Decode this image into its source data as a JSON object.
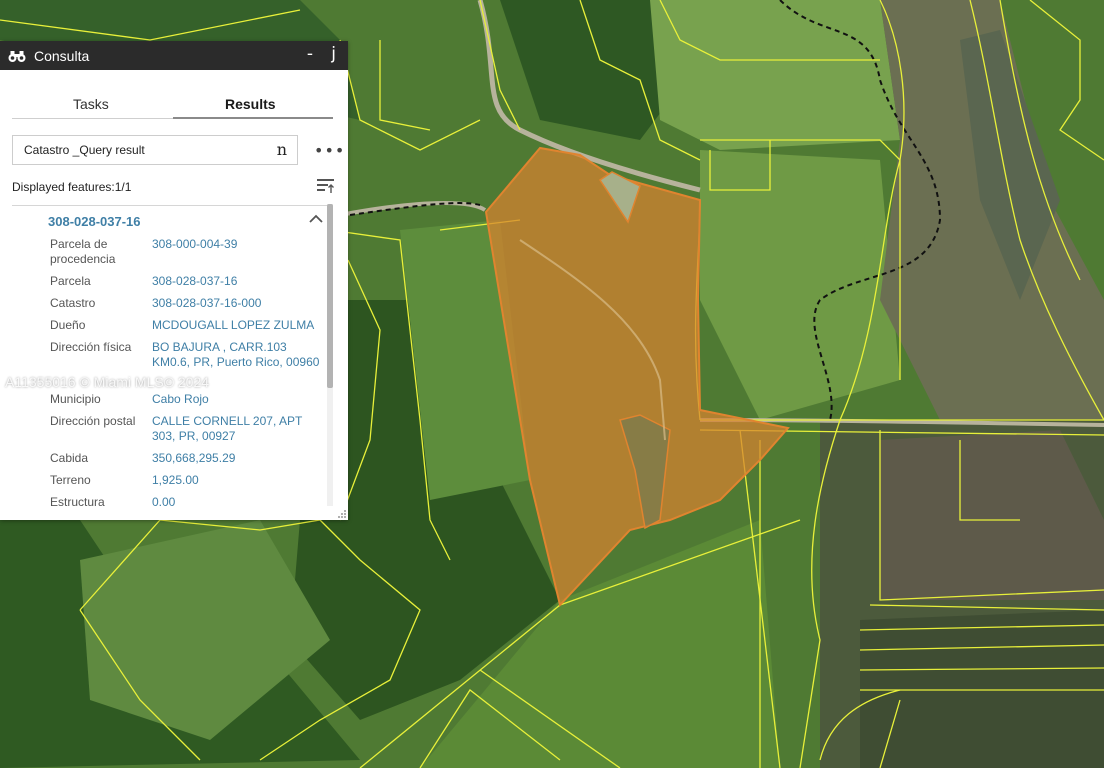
{
  "map": {
    "watermark": "A11355016 © Miami MLS© 2024"
  },
  "panel": {
    "title": "Consulta",
    "title_icon": "binoculars-icon",
    "minimize_label": "-",
    "close_label": "j",
    "tabs": [
      {
        "label": "Tasks",
        "active": false
      },
      {
        "label": "Results",
        "active": true
      }
    ],
    "query_result": {
      "label": "Catastro _Query result",
      "button_glyph": "n"
    },
    "more_options_label": "•••",
    "displayed_features": "Displayed features:1/1",
    "feature": {
      "title": "308-028-037-16",
      "attributes": [
        {
          "label": "Parcela de procedencia",
          "value": "308-000-004-39"
        },
        {
          "label": "Parcela",
          "value": "308-028-037-16"
        },
        {
          "label": "Catastro",
          "value": "308-028-037-16-000"
        },
        {
          "label": "Dueño",
          "value": "MCDOUGALL LOPEZ ZULMA"
        },
        {
          "label": "Dirección física",
          "value": "BO BAJURA , CARR.103 KM0.6, PR, Puerto Rico, 00960"
        },
        {
          "label": "Municipio",
          "value": "Cabo Rojo"
        },
        {
          "label": "Dirección postal",
          "value": "CALLE CORNELL 207, APT 303, PR, 00927"
        },
        {
          "label": "Cabida",
          "value": "350,668,295.29"
        },
        {
          "label": "Terreno",
          "value": "1,925.00"
        },
        {
          "label": "Estructura",
          "value": "0.00"
        }
      ]
    }
  },
  "colors": {
    "header_bg": "#2b2b2b",
    "link_blue": "#3f7fa6",
    "parcel_fill": "#d7822f",
    "parcel_lines": "#e8f03a"
  }
}
